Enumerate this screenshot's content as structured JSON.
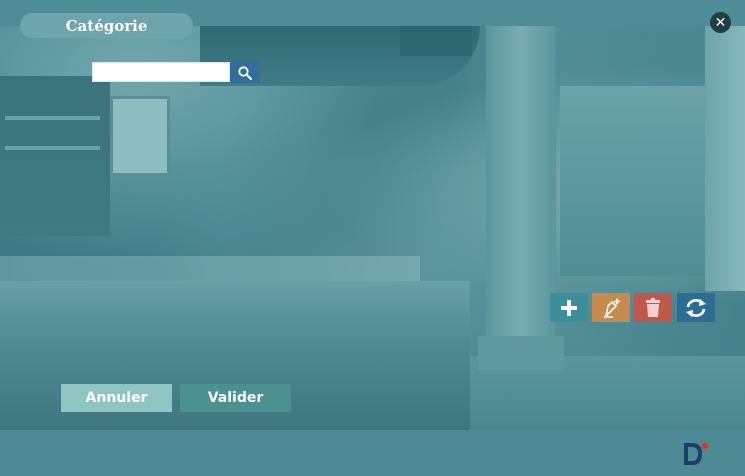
{
  "window": {
    "title": "Catégorie",
    "close_glyph": "✕"
  },
  "search": {
    "value": "",
    "placeholder": "",
    "icon": "search-icon"
  },
  "toolbar": {
    "add_icon": "plus-icon",
    "edit_icon": "pen-plus-icon",
    "delete_icon": "trash-icon",
    "refresh_icon": "refresh-icon"
  },
  "buttons": {
    "cancel_label": "Annuler",
    "validate_label": "Valider"
  },
  "colors": {
    "add": "#3c8f9a",
    "edit": "#c58a4d",
    "delete": "#c0574c",
    "refresh": "#2c6d95",
    "cancel": "#8fc5c0",
    "validate": "#4a918f"
  }
}
